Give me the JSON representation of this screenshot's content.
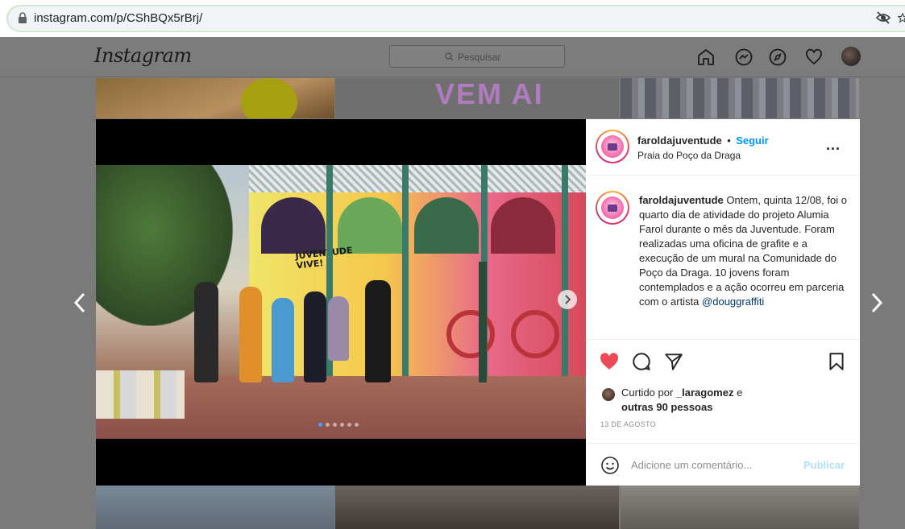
{
  "browser": {
    "url": "instagram.com/p/CShBQx5rBrj/"
  },
  "header": {
    "logo": "Instagram",
    "search_placeholder": "Pesquisar"
  },
  "background": {
    "banner_text": "VEM AI"
  },
  "post": {
    "username": "faroldajuventude",
    "separator": "•",
    "follow_label": "Seguir",
    "location": "Praia do Poço da Draga",
    "more_label": "...",
    "caption_username": "faroldajuventude",
    "caption_text": " Ontem, quinta 12/08, foi o quarto dia de atividade do projeto Alumia Farol durante o mês da Juventude. Foram realizadas uma oficina de grafite e a execução de um mural na Comunidade do Poço da Draga. 10 jovens foram contemplados e a ação ocorreu em parceria com o artista ",
    "caption_mention": "@douggraffiti",
    "liked_prefix": "Curtido por ",
    "liked_user": "_laragomez",
    "liked_middle": " e",
    "liked_others": "outras 90 pessoas",
    "date": "13 DE AGOSTO",
    "comment_placeholder": "Adicione um comentário...",
    "publish_label": "Publicar",
    "photo_text": "JUVENTUDE VIVE!"
  },
  "carousel": {
    "dots": 6,
    "active_dot": 0
  },
  "colors": {
    "like": "#ed4956",
    "follow": "#0095f6",
    "publish_disabled": "#b2dffc"
  }
}
